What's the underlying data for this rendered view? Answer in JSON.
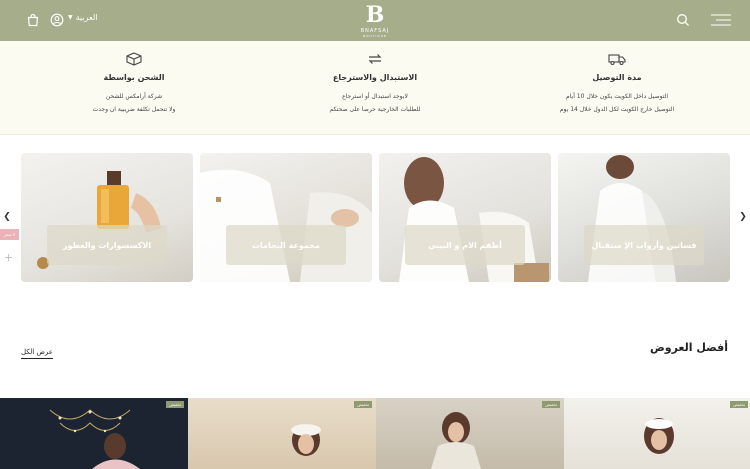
{
  "header": {
    "language_label": "العربية",
    "logo": {
      "mark": "B",
      "name": "BNAFSAJ",
      "tagline": "BOUTIQUE"
    }
  },
  "features": [
    {
      "title": "مدة التوصيل",
      "lines": [
        "التوصيل داخل الكويت يكون خلال 10 أيام",
        "التوصيل خارج الكويت لكل الدول خلال 14 يوم"
      ],
      "icon": "truck-icon"
    },
    {
      "title": "الاستبدال والاسترجاع",
      "lines": [
        "لايوجد استبدال أو استرجاع",
        "للطلبات الخارجية حرصا على صحتكم"
      ],
      "icon": "exchange-icon"
    },
    {
      "title": "الشحن بواسطة",
      "lines": [
        "شركة أرامكس للشحن",
        "ولا نتحمل تكلفة ضريبية ان وجدت"
      ],
      "icon": "box-icon"
    }
  ],
  "categories": [
    {
      "label": "فساتين وأرواب الإ ستقبال"
    },
    {
      "label": "أطقم الام و البيبي"
    },
    {
      "label": "مجموعة البجامات"
    },
    {
      "label": "الاكسسوارات والعطور"
    }
  ],
  "side_badge": "لا سعر",
  "best_offers": {
    "title": "أفضل العروض",
    "view_all": "عرض الكل"
  },
  "products": [
    {
      "badge": "تخفيض"
    },
    {
      "badge": "تخفيض"
    },
    {
      "badge": "تخفيض"
    },
    {
      "badge": "تخفيض"
    }
  ],
  "colors": {
    "header_bg": "#a6ad8a",
    "strip_bg": "#fcfbf2",
    "badge": "#8e9a6f"
  }
}
